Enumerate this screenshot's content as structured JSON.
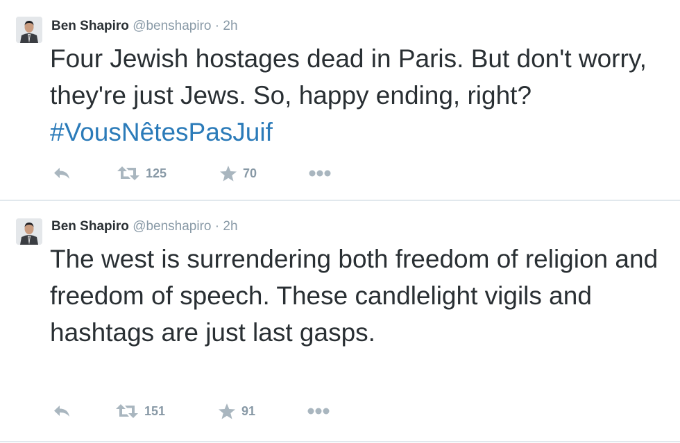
{
  "tweets": [
    {
      "author_name": "Ben Shapiro",
      "handle": "@benshapiro",
      "separator": "·",
      "time": "2h",
      "text": "Four Jewish hostages dead in Paris. But don't worry, they're just Jews. So, happy ending, right? ",
      "hashtag": "#VousNêtesPasJuif",
      "retweets": "125",
      "favorites": "70"
    },
    {
      "author_name": "Ben Shapiro",
      "handle": "@benshapiro",
      "separator": "·",
      "time": "2h",
      "text": "The west is surrendering both freedom of religion and freedom of speech. These candlelight vigils and hashtags are just last gasps.",
      "retweets": "151",
      "favorites": "91"
    }
  ],
  "colors": {
    "text": "#292f33",
    "muted": "#8899a6",
    "hashtag": "#2b7bb9",
    "icon": "#a9b6bf",
    "divider": "#e1e8ed"
  },
  "icons": [
    "avatar",
    "reply-icon",
    "retweet-icon",
    "favorite-icon",
    "more-icon"
  ]
}
